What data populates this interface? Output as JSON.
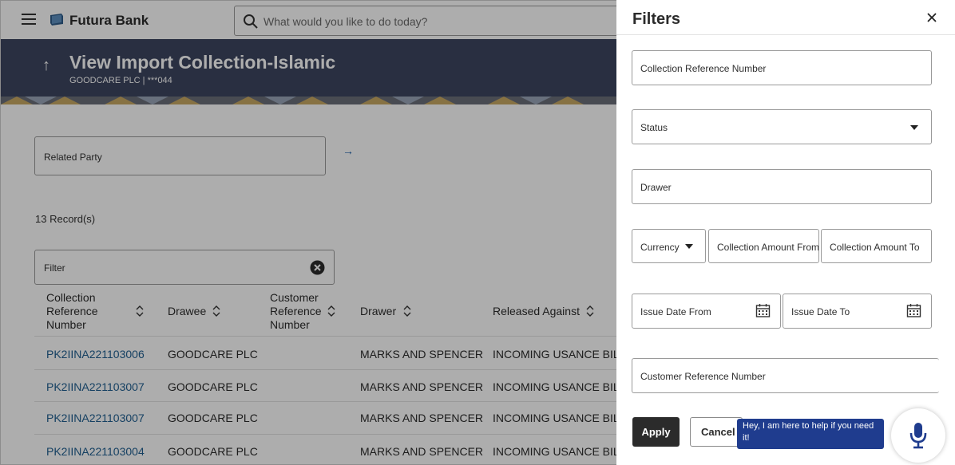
{
  "app": {
    "bank_name": "Futura Bank",
    "search_placeholder": "What would you like to do today?"
  },
  "header": {
    "title": "View Import Collection-Islamic",
    "subtitle": "GOODCARE PLC | ***044"
  },
  "main": {
    "related_party_label": "Related Party",
    "records_count": "13 Record(s)",
    "filter_label": "Filter",
    "table": {
      "columns": [
        "Collection\nReference\nNumber",
        "Drawee",
        "Customer\nReference\nNumber",
        "Drawer",
        "Released Against"
      ],
      "rows": [
        {
          "ref": "PK2IINA221103006",
          "drawee": "GOODCARE PLC",
          "customer_ref": "",
          "drawer": "MARKS AND SPENCER",
          "released": "INCOMING USANCE BILLS"
        },
        {
          "ref": "PK2IINA221103007",
          "drawee": "GOODCARE PLC",
          "customer_ref": "",
          "drawer": "MARKS AND SPENCER",
          "released": "INCOMING USANCE BILLS"
        },
        {
          "ref": "PK2IINA221103007",
          "drawee": "GOODCARE PLC",
          "customer_ref": "",
          "drawer": "MARKS AND SPENCER",
          "released": "INCOMING USANCE BILLS"
        },
        {
          "ref": "PK2IINA221103004",
          "drawee": "GOODCARE PLC",
          "customer_ref": "",
          "drawer": "MARKS AND SPENCER",
          "released": "INCOMING USANCE BILLS"
        }
      ]
    }
  },
  "filters": {
    "title": "Filters",
    "collection_ref": "Collection Reference Number",
    "status": "Status",
    "drawer": "Drawer",
    "currency": "Currency",
    "amount_from": "Collection Amount From",
    "amount_to": "Collection Amount To",
    "issue_date_from": "Issue Date From",
    "issue_date_to": "Issue Date To",
    "customer_ref": "Customer Reference Number",
    "apply": "Apply",
    "cancel": "Cancel"
  },
  "assistant": {
    "message": "Hey, I am here to help if you need it!"
  },
  "colors": {
    "banner": "#3d4660",
    "link": "#1f5f91",
    "chat": "#1f3c8e",
    "apply_button": "#2b2b2b"
  },
  "icons": [
    "menu-icon",
    "bank-logo-icon",
    "search-icon",
    "back-arrow-icon",
    "arrow-right-icon",
    "clear-icon",
    "sort-icon",
    "close-icon",
    "chevron-down-icon",
    "calendar-icon",
    "microphone-icon"
  ]
}
